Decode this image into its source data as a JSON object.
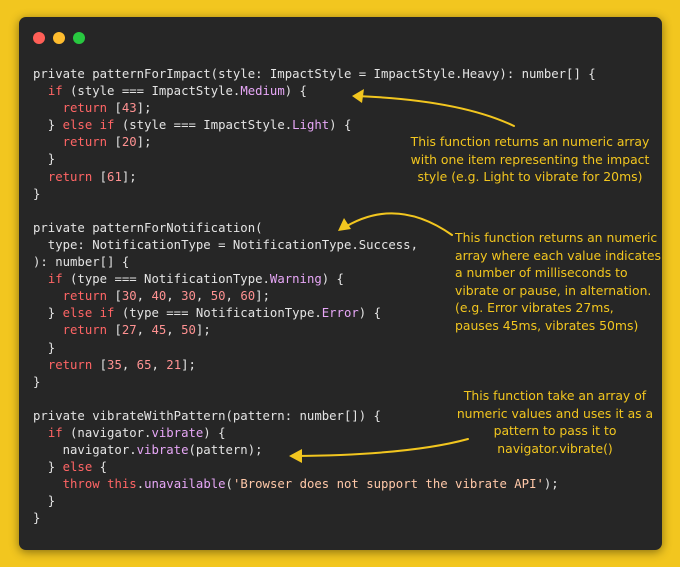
{
  "window": {
    "traffic_lights": [
      {
        "name": "close",
        "color": "#ff5f57"
      },
      {
        "name": "minimize",
        "color": "#febc2e"
      },
      {
        "name": "maximize",
        "color": "#28c840"
      }
    ]
  },
  "colors": {
    "background": "#f2c61f",
    "editor": "#262626",
    "text": "#e4e4e4",
    "keyword": "#ff6565",
    "number": "#ff9292",
    "property": "#e7a7f7",
    "string": "#ffc8a8",
    "annotation": "#f2c61f"
  },
  "code": [
    [
      {
        "t": "private patternForImpact(style: ImpactStyle = ImpactStyle.Heavy): number[] {"
      }
    ],
    [
      {
        "t": "  "
      },
      {
        "t": "if",
        "c": "kw"
      },
      {
        "t": " (style === ImpactStyle."
      },
      {
        "t": "Medium",
        "c": "prop"
      },
      {
        "t": ") {"
      }
    ],
    [
      {
        "t": "    "
      },
      {
        "t": "return",
        "c": "kw"
      },
      {
        "t": " ["
      },
      {
        "t": "43",
        "c": "num"
      },
      {
        "t": "];"
      }
    ],
    [
      {
        "t": "  } "
      },
      {
        "t": "else if",
        "c": "kw"
      },
      {
        "t": " (style === ImpactStyle."
      },
      {
        "t": "Light",
        "c": "prop"
      },
      {
        "t": ") {"
      }
    ],
    [
      {
        "t": "    "
      },
      {
        "t": "return",
        "c": "kw"
      },
      {
        "t": " ["
      },
      {
        "t": "20",
        "c": "num"
      },
      {
        "t": "];"
      }
    ],
    [
      {
        "t": "  }"
      }
    ],
    [
      {
        "t": "  "
      },
      {
        "t": "return",
        "c": "kw"
      },
      {
        "t": " ["
      },
      {
        "t": "61",
        "c": "num"
      },
      {
        "t": "];"
      }
    ],
    [
      {
        "t": "}"
      }
    ],
    [
      {
        "t": ""
      }
    ],
    [
      {
        "t": "private patternForNotification("
      }
    ],
    [
      {
        "t": "  type: NotificationType = NotificationType.Success,"
      }
    ],
    [
      {
        "t": "): number[] {"
      }
    ],
    [
      {
        "t": "  "
      },
      {
        "t": "if",
        "c": "kw"
      },
      {
        "t": " (type === NotificationType."
      },
      {
        "t": "Warning",
        "c": "prop"
      },
      {
        "t": ") {"
      }
    ],
    [
      {
        "t": "    "
      },
      {
        "t": "return",
        "c": "kw"
      },
      {
        "t": " ["
      },
      {
        "t": "30",
        "c": "num"
      },
      {
        "t": ", "
      },
      {
        "t": "40",
        "c": "num"
      },
      {
        "t": ", "
      },
      {
        "t": "30",
        "c": "num"
      },
      {
        "t": ", "
      },
      {
        "t": "50",
        "c": "num"
      },
      {
        "t": ", "
      },
      {
        "t": "60",
        "c": "num"
      },
      {
        "t": "];"
      }
    ],
    [
      {
        "t": "  } "
      },
      {
        "t": "else if",
        "c": "kw"
      },
      {
        "t": " (type === NotificationType."
      },
      {
        "t": "Error",
        "c": "prop"
      },
      {
        "t": ") {"
      }
    ],
    [
      {
        "t": "    "
      },
      {
        "t": "return",
        "c": "kw"
      },
      {
        "t": " ["
      },
      {
        "t": "27",
        "c": "num"
      },
      {
        "t": ", "
      },
      {
        "t": "45",
        "c": "num"
      },
      {
        "t": ", "
      },
      {
        "t": "50",
        "c": "num"
      },
      {
        "t": "];"
      }
    ],
    [
      {
        "t": "  }"
      }
    ],
    [
      {
        "t": "  "
      },
      {
        "t": "return",
        "c": "kw"
      },
      {
        "t": " ["
      },
      {
        "t": "35",
        "c": "num"
      },
      {
        "t": ", "
      },
      {
        "t": "65",
        "c": "num"
      },
      {
        "t": ", "
      },
      {
        "t": "21",
        "c": "num"
      },
      {
        "t": "];"
      }
    ],
    [
      {
        "t": "}"
      }
    ],
    [
      {
        "t": ""
      }
    ],
    [
      {
        "t": "private vibrateWithPattern(pattern: number[]) {"
      }
    ],
    [
      {
        "t": "  "
      },
      {
        "t": "if",
        "c": "kw"
      },
      {
        "t": " (navigator."
      },
      {
        "t": "vibrate",
        "c": "prop"
      },
      {
        "t": ") {"
      }
    ],
    [
      {
        "t": "    navigator."
      },
      {
        "t": "vibrate",
        "c": "prop"
      },
      {
        "t": "(pattern);"
      }
    ],
    [
      {
        "t": "  } "
      },
      {
        "t": "else",
        "c": "kw"
      },
      {
        "t": " {"
      }
    ],
    [
      {
        "t": "    "
      },
      {
        "t": "throw",
        "c": "kw"
      },
      {
        "t": " "
      },
      {
        "t": "this",
        "c": "kw"
      },
      {
        "t": "."
      },
      {
        "t": "unavailable",
        "c": "prop"
      },
      {
        "t": "("
      },
      {
        "t": "'Browser does not support the vibrate API'",
        "c": "str"
      },
      {
        "t": ");"
      }
    ],
    [
      {
        "t": "  }"
      }
    ],
    [
      {
        "t": "}"
      }
    ]
  ],
  "annotations": {
    "impact": [
      "This function returns an numeric array",
      "with one item representing the impact",
      "style (e.g. Light to vibrate for 20ms)"
    ],
    "notification": [
      "This function returns an numeric",
      "array where each value indicates",
      "a number of milliseconds to",
      "vibrate or pause, in alternation.",
      "(e.g. Error vibrates 27ms,",
      "pauses 45ms, vibrates 50ms)"
    ],
    "vibrate": [
      "This function take an array of",
      "numeric values and uses it as a",
      "pattern to pass it to",
      "navigator.vibrate()"
    ]
  }
}
